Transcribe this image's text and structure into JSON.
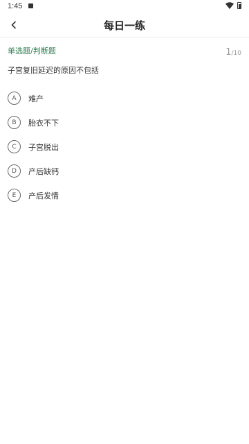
{
  "status_bar": {
    "time": "1:45"
  },
  "header": {
    "title": "每日一练"
  },
  "question": {
    "type": "单选题/判断题",
    "current": "1",
    "total": "/10",
    "text": "子宫复旧延迟的原因不包括"
  },
  "options": [
    {
      "letter": "A",
      "text": "难产"
    },
    {
      "letter": "B",
      "text": "胎衣不下"
    },
    {
      "letter": "C",
      "text": "子宫脱出"
    },
    {
      "letter": "D",
      "text": "产后缺钙"
    },
    {
      "letter": "E",
      "text": "产后发情"
    }
  ]
}
